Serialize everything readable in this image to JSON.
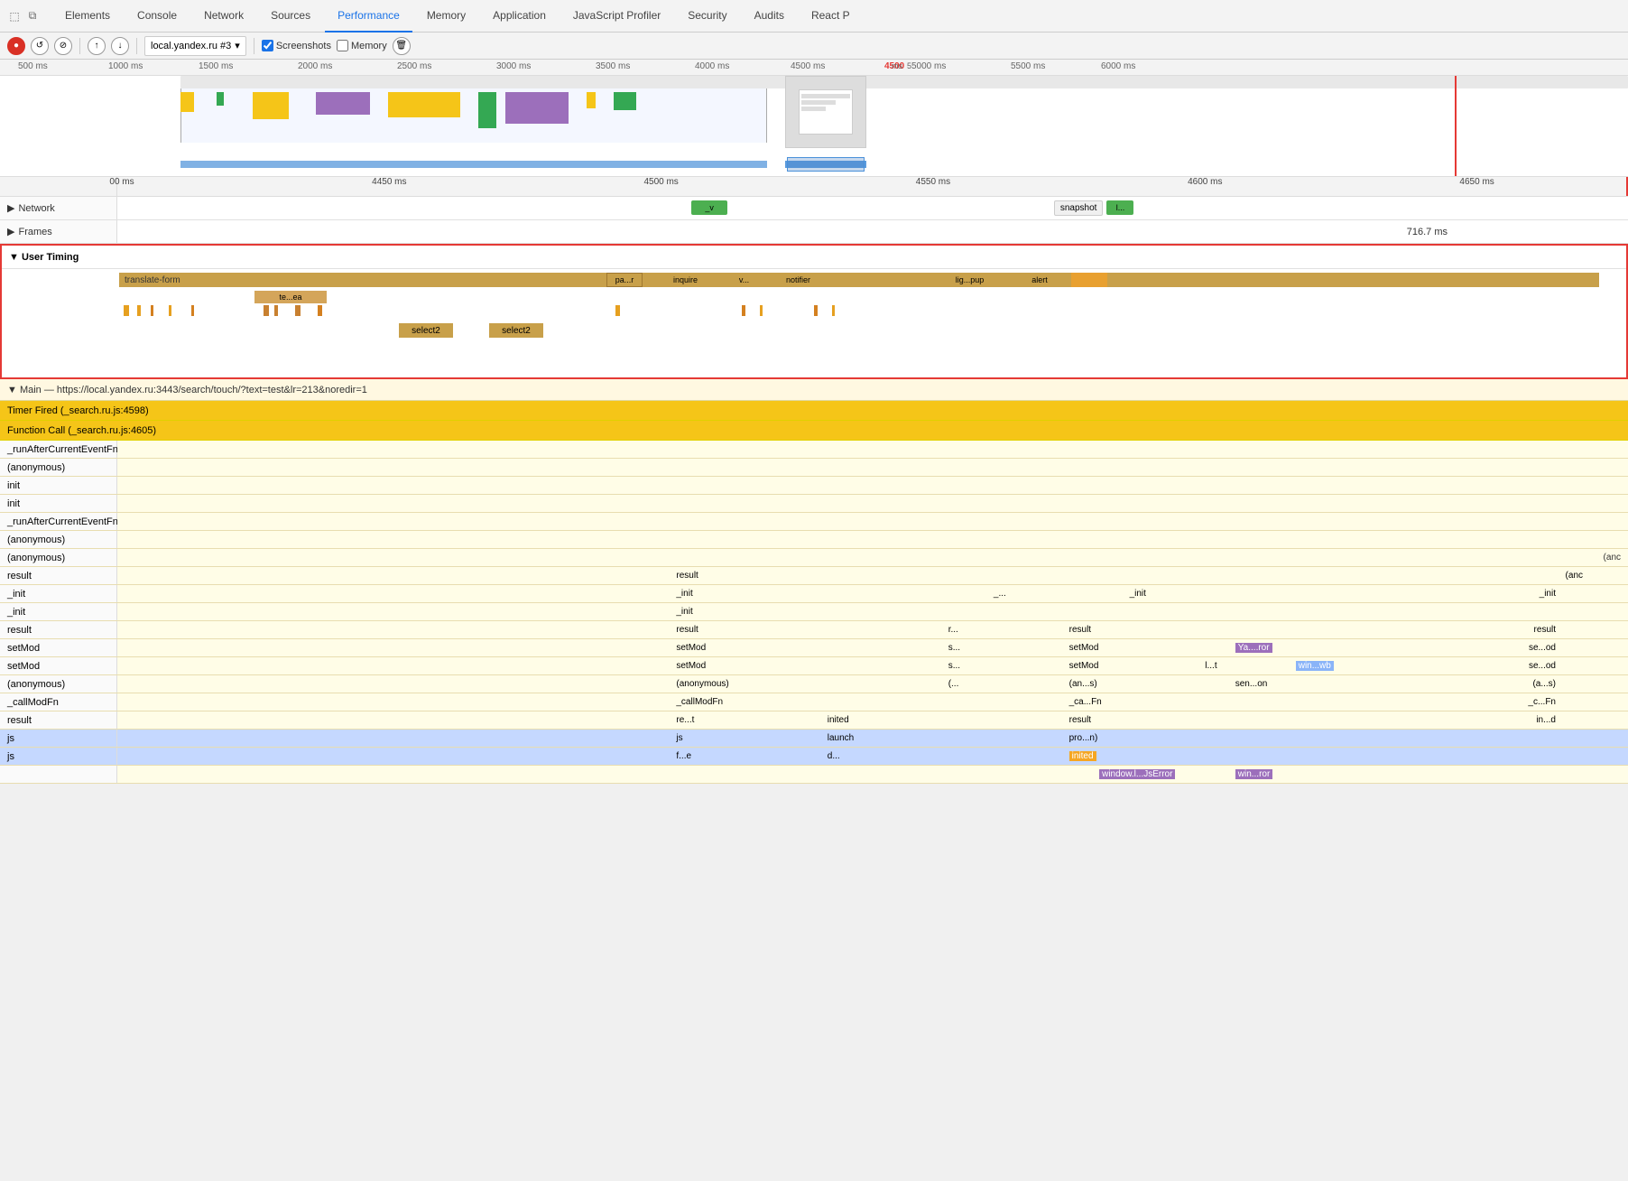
{
  "tabs": {
    "items": [
      {
        "id": "elements",
        "label": "Elements",
        "active": false
      },
      {
        "id": "console",
        "label": "Console",
        "active": false
      },
      {
        "id": "network",
        "label": "Network",
        "active": false
      },
      {
        "id": "sources",
        "label": "Sources",
        "active": false
      },
      {
        "id": "performance",
        "label": "Performance",
        "active": true
      },
      {
        "id": "memory",
        "label": "Memory",
        "active": false
      },
      {
        "id": "application",
        "label": "Application",
        "active": false
      },
      {
        "id": "js-profiler",
        "label": "JavaScript Profiler",
        "active": false
      },
      {
        "id": "security",
        "label": "Security",
        "active": false
      },
      {
        "id": "audits",
        "label": "Audits",
        "active": false
      },
      {
        "id": "react",
        "label": "React P",
        "active": false
      }
    ]
  },
  "toolbar": {
    "url": "local.yandex.ru #3",
    "screenshots_label": "Screenshots",
    "memory_label": "Memory"
  },
  "timeline": {
    "overview_ticks": [
      "500 ms",
      "1000 ms",
      "1500 ms",
      "2000 ms",
      "2500 ms",
      "3000 ms",
      "3500 ms",
      "4000 ms",
      "4500 ms",
      "5000 ms",
      "5500 ms",
      "6000 ms"
    ],
    "detail_ticks": [
      "00 ms",
      "4450 ms",
      "4500 ms",
      "4550 ms",
      "4600 ms",
      "4650 ms"
    ],
    "network_label": "Network",
    "frames_label": "Frames",
    "frames_value": "716.7 ms",
    "snapshot_text": "snapshot",
    "user_timing_label": "User Timing",
    "translate_form": "translate-form",
    "te_ea": "te...ea",
    "select2_1": "select2",
    "select2_2": "select2",
    "pa_r": "pa...r",
    "inquire": "inquire",
    "v": "v...",
    "notifier": "notifier",
    "lig_pup": "lig...pup",
    "alert": "alert"
  },
  "main_thread": {
    "url": "Main — https://local.yandex.ru:3443/search/touch/?text=test&lr=213&noredir=1",
    "timer_fired": "Timer Fired (_search.ru.js:4598)",
    "function_call": "Function Call (_search.ru.js:4605)",
    "stack_items": [
      "_runAfterCurrentEventFns",
      "(anonymous)",
      "init",
      "init",
      "_runAfterCurrentEventFns",
      "(anonymous)",
      "(anonymous)",
      "result",
      "_init",
      "_init",
      "result",
      "setMod",
      "setMod",
      "(anonymous)",
      "_callModFn",
      "result",
      "js",
      "js"
    ],
    "col2_items": [
      "",
      "",
      "",
      "",
      "",
      "",
      "",
      "result",
      "_init",
      "",
      "result",
      "setMod",
      "setMod",
      "(anonymous)",
      "_callModFn",
      "re...t",
      "js",
      "f...e"
    ],
    "right_col_items": [
      "",
      "",
      "",
      "",
      "",
      "",
      "(anc",
      "(anc",
      "",
      "",
      "",
      "",
      "",
      "",
      "",
      "in...d",
      "",
      "d..."
    ]
  }
}
